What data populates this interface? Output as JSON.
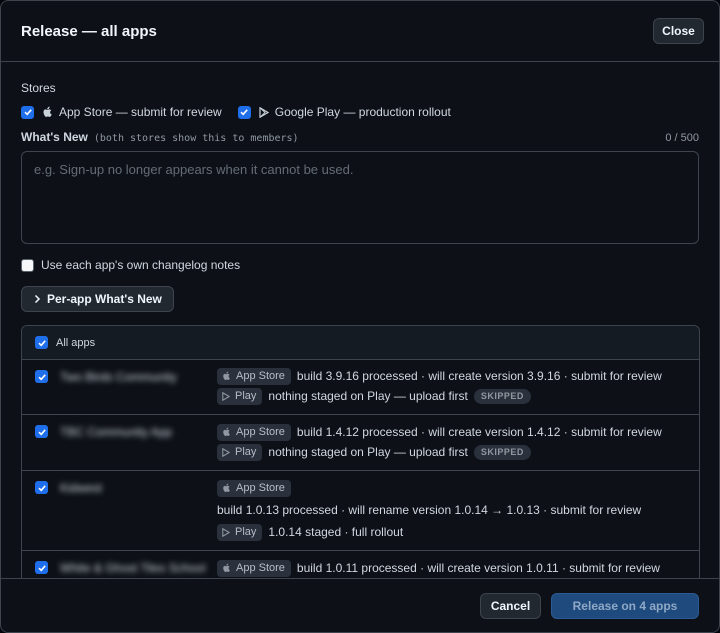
{
  "dialog": {
    "title": "Release — all apps",
    "close_label": "Close"
  },
  "stores": {
    "label": "Stores",
    "items": [
      {
        "label": "App Store — submit for review",
        "checked": true,
        "icon": "apple-icon"
      },
      {
        "label": "Google Play — production rollout",
        "checked": true,
        "icon": "play-icon"
      }
    ]
  },
  "whats_new": {
    "label": "What's New",
    "hint": "(both stores show this to members)",
    "count": "0 / 500",
    "placeholder": "e.g. Sign-up no longer appears when it cannot be used.",
    "value": ""
  },
  "own_notes": {
    "label": "Use each app's own changelog notes",
    "checked": false
  },
  "per_app_button": "Per-app What's New",
  "apps": {
    "header": "All apps",
    "rows": [
      {
        "name": "Two Birds Community",
        "checked": true,
        "lines": [
          {
            "store": "App Store",
            "text": "build 3.9.16 processed · will create version 3.9.16 · submit for review"
          },
          {
            "store": "Play",
            "text": "nothing staged on Play — upload first",
            "badge": "SKIPPED"
          }
        ]
      },
      {
        "name": "TBC Community App",
        "checked": true,
        "lines": [
          {
            "store": "App Store",
            "text": "build 1.4.12 processed · will create version 1.4.12 · submit for review"
          },
          {
            "store": "Play",
            "text": "nothing staged on Play — upload first",
            "badge": "SKIPPED"
          }
        ]
      },
      {
        "name": "Kidwest",
        "checked": true,
        "lines": [
          {
            "store": "App Store",
            "text": ""
          },
          {
            "store": "",
            "text": "build 1.0.13 processed · will rename version 1.0.14 → 1.0.13 · submit for review"
          },
          {
            "store": "Play",
            "text": "1.0.14 staged · full rollout"
          }
        ]
      },
      {
        "name": "White & Ghost Tiles School",
        "checked": true,
        "lines": [
          {
            "store": "App Store",
            "text": "build 1.0.11 processed · will create version 1.0.11 · submit for review"
          }
        ]
      }
    ]
  },
  "footer": {
    "cancel_label": "Cancel",
    "release_label": "Release on 4 apps"
  }
}
